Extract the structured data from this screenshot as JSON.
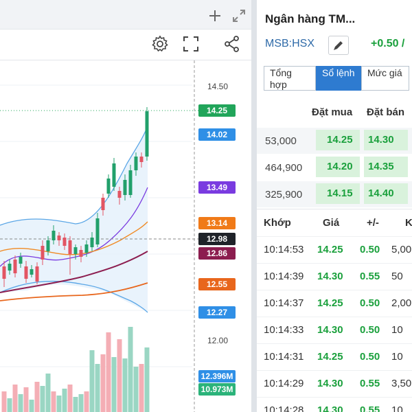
{
  "chart": {
    "axis_labels": [
      "14.50",
      "12.00"
    ],
    "price_tags": [
      {
        "text": "14.25",
        "color": "#21a55a"
      },
      {
        "text": "14.02",
        "color": "#2f8fe6"
      },
      {
        "text": "13.49",
        "color": "#7a3be0"
      },
      {
        "text": "13.14",
        "color": "#f07a18"
      },
      {
        "text": "12.98",
        "color": "#1f2329"
      },
      {
        "text": "12.86",
        "color": "#8c1d4f"
      },
      {
        "text": "12.55",
        "color": "#e8661c"
      },
      {
        "text": "12.27",
        "color": "#2f8fe6"
      },
      {
        "text": "12.396M",
        "color": "#2f8fe6"
      },
      {
        "text": "10.973M",
        "color": "#2bb37a"
      }
    ],
    "icons": [
      "add-icon",
      "expand-icon",
      "settings-icon",
      "fullscreen-icon",
      "share-icon"
    ]
  },
  "quote": {
    "title": "Ngân hàng TM...",
    "ticker": "MSB:HSX",
    "change": "+0.50 /",
    "tabs": [
      "Tổng hợp",
      "Sổ lệnh",
      "Mức giá"
    ],
    "active_tab": 1
  },
  "order_book": {
    "headers": {
      "bid": "Đặt mua",
      "ask": "Đặt bán"
    },
    "rows": [
      {
        "volume": "53,000",
        "bid": "14.25",
        "ask": "14.30"
      },
      {
        "volume": "464,900",
        "bid": "14.20",
        "ask": "14.35"
      },
      {
        "volume": "325,900",
        "bid": "14.15",
        "ask": "14.40"
      }
    ]
  },
  "trades": {
    "headers": {
      "time": "Khớp",
      "price": "Giá",
      "change": "+/-",
      "volume": "K"
    },
    "rows": [
      {
        "time": "10:14:53",
        "price": "14.25",
        "change": "0.50",
        "volume": "5,00"
      },
      {
        "time": "10:14:39",
        "price": "14.30",
        "change": "0.55",
        "volume": "50"
      },
      {
        "time": "10:14:37",
        "price": "14.25",
        "change": "0.50",
        "volume": "2,00"
      },
      {
        "time": "10:14:33",
        "price": "14.30",
        "change": "0.50",
        "volume": "10"
      },
      {
        "time": "10:14:31",
        "price": "14.25",
        "change": "0.50",
        "volume": "10"
      },
      {
        "time": "10:14:29",
        "price": "14.30",
        "change": "0.55",
        "volume": "3,50"
      },
      {
        "time": "10:14:28",
        "price": "14.30",
        "change": "0.55",
        "volume": "10"
      }
    ]
  }
}
